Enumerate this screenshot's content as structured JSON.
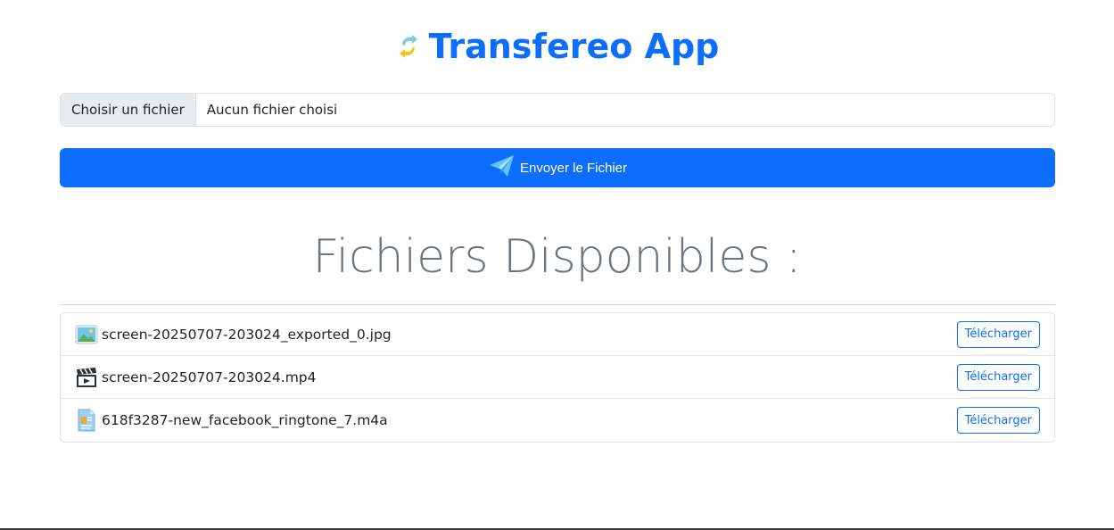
{
  "header": {
    "title": "Transfereo App",
    "logo_icon": "repeat-arrow-icon"
  },
  "upload": {
    "choose_label": "Choisir un fichier",
    "file_status": "Aucun fichier choisi",
    "send_label": "Envoyer le Fichier",
    "send_icon": "paper-plane-icon"
  },
  "files_section": {
    "title": "Fichiers Disponibles :",
    "items": [
      {
        "name": "screen-20250707-203024_exported_0.jpg",
        "icon": "image-file-icon",
        "action": "Télécharger"
      },
      {
        "name": "screen-20250707-203024.mp4",
        "icon": "video-clapper-icon",
        "action": "Télécharger"
      },
      {
        "name": "618f3287-new_facebook_ringtone_7.m4a",
        "icon": "document-file-icon",
        "action": "Télécharger"
      }
    ]
  },
  "colors": {
    "primary": "#0d6efd",
    "muted_title": "#6c757d",
    "border": "#dee2e6"
  }
}
